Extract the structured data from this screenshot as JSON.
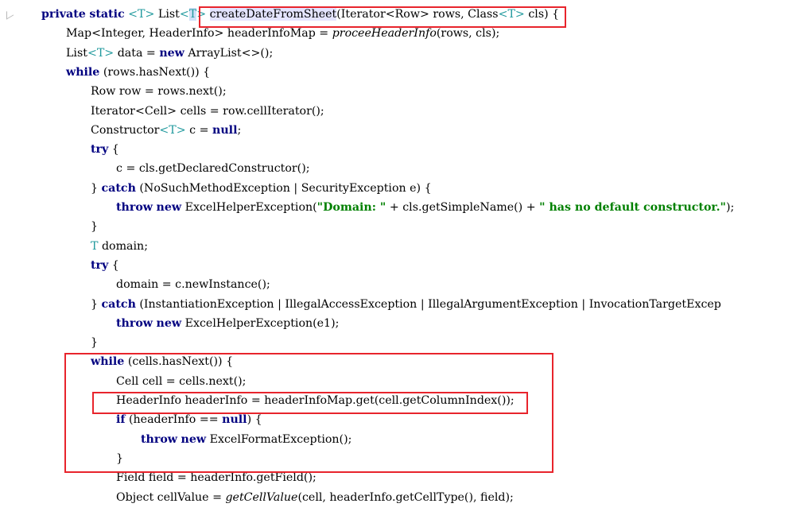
{
  "editor": {
    "lines": [
      [
        {
          "t": "private",
          "c": "kw"
        },
        {
          "t": " "
        },
        {
          "t": "static",
          "c": "kw"
        },
        {
          "t": " "
        },
        {
          "t": "<T>",
          "c": "tp"
        },
        {
          "t": " List"
        },
        {
          "t": "<",
          "c": "tp"
        },
        {
          "t": "T",
          "c": "tp hl2"
        },
        {
          "t": ">",
          "c": "tp"
        },
        {
          "t": " "
        },
        {
          "t": "createDateFromSheet",
          "c": "hl"
        },
        {
          "t": "(Iterator<Row> rows, Class"
        },
        {
          "t": "<T>",
          "c": "tp"
        },
        {
          "t": " cls) {"
        }
      ],
      [
        {
          "t": "Map<Integer, HeaderInfo> headerInfoMap = "
        },
        {
          "t": "proceeHeaderInfo",
          "c": "it"
        },
        {
          "t": "(rows, cls);"
        }
      ],
      [
        {
          "t": "List"
        },
        {
          "t": "<T>",
          "c": "tp"
        },
        {
          "t": " data = "
        },
        {
          "t": "new",
          "c": "kw"
        },
        {
          "t": " ArrayList<>();"
        }
      ],
      [
        {
          "t": "while",
          "c": "kw"
        },
        {
          "t": " (rows.hasNext()) {"
        }
      ],
      [
        {
          "t": "Row row = rows.next();"
        }
      ],
      [
        {
          "t": "Iterator<Cell> cells = row.cellIterator();"
        }
      ],
      [
        {
          "t": "Constructor"
        },
        {
          "t": "<T>",
          "c": "tp"
        },
        {
          "t": " c = "
        },
        {
          "t": "null",
          "c": "kw"
        },
        {
          "t": ";"
        }
      ],
      [
        {
          "t": "try",
          "c": "kw"
        },
        {
          "t": " {"
        }
      ],
      [
        {
          "t": "c = cls.getDeclaredConstructor();"
        }
      ],
      [
        {
          "t": "} "
        },
        {
          "t": "catch",
          "c": "kw"
        },
        {
          "t": " (NoSuchMethodException | SecurityException e) {"
        }
      ],
      [
        {
          "t": "throw",
          "c": "kw"
        },
        {
          "t": " "
        },
        {
          "t": "new",
          "c": "kw"
        },
        {
          "t": " ExcelHelperException("
        },
        {
          "t": "\"Domain: \"",
          "c": "str"
        },
        {
          "t": " + cls.getSimpleName() + "
        },
        {
          "t": "\" has no default constructor.\"",
          "c": "str"
        },
        {
          "t": ");"
        }
      ],
      [
        {
          "t": "}"
        }
      ],
      [
        {
          "t": "T",
          "c": "tp"
        },
        {
          "t": " domain;"
        }
      ],
      [
        {
          "t": "try",
          "c": "kw"
        },
        {
          "t": " {"
        }
      ],
      [
        {
          "t": "domain = c.newInstance();"
        }
      ],
      [
        {
          "t": "} "
        },
        {
          "t": "catch",
          "c": "kw"
        },
        {
          "t": " (InstantiationException | IllegalAccessException | IllegalArgumentException | InvocationTargetExcep"
        }
      ],
      [
        {
          "t": "throw",
          "c": "kw"
        },
        {
          "t": " "
        },
        {
          "t": "new",
          "c": "kw"
        },
        {
          "t": " ExcelHelperException(e1);"
        }
      ],
      [
        {
          "t": "}"
        }
      ],
      [
        {
          "t": "while",
          "c": "kw"
        },
        {
          "t": " (cells.hasNext()) {"
        }
      ],
      [
        {
          "t": "Cell cell = cells.next();"
        }
      ],
      [
        {
          "t": "HeaderInfo headerInfo = headerInfoMap.get(cell.getColumnIndex());"
        }
      ],
      [
        {
          "t": "if",
          "c": "kw"
        },
        {
          "t": " (headerInfo == "
        },
        {
          "t": "null",
          "c": "kw"
        },
        {
          "t": ") {"
        }
      ],
      [
        {
          "t": "throw",
          "c": "kw"
        },
        {
          "t": " "
        },
        {
          "t": "new",
          "c": "kw"
        },
        {
          "t": " ExcelFormatException();"
        }
      ],
      [
        {
          "t": "}"
        }
      ],
      [
        {
          "t": "Field field = headerInfo.getField();"
        }
      ],
      [
        {
          "t": "Object cellValue = "
        },
        {
          "t": "getCellValue",
          "c": "it"
        },
        {
          "t": "(cell, headerInfo.getCellType(), field);"
        }
      ]
    ]
  },
  "annotations": [
    {
      "label": "method-signature-highlight"
    },
    {
      "label": "while-loop-highlight"
    },
    {
      "label": "header-info-line-highlight"
    }
  ]
}
